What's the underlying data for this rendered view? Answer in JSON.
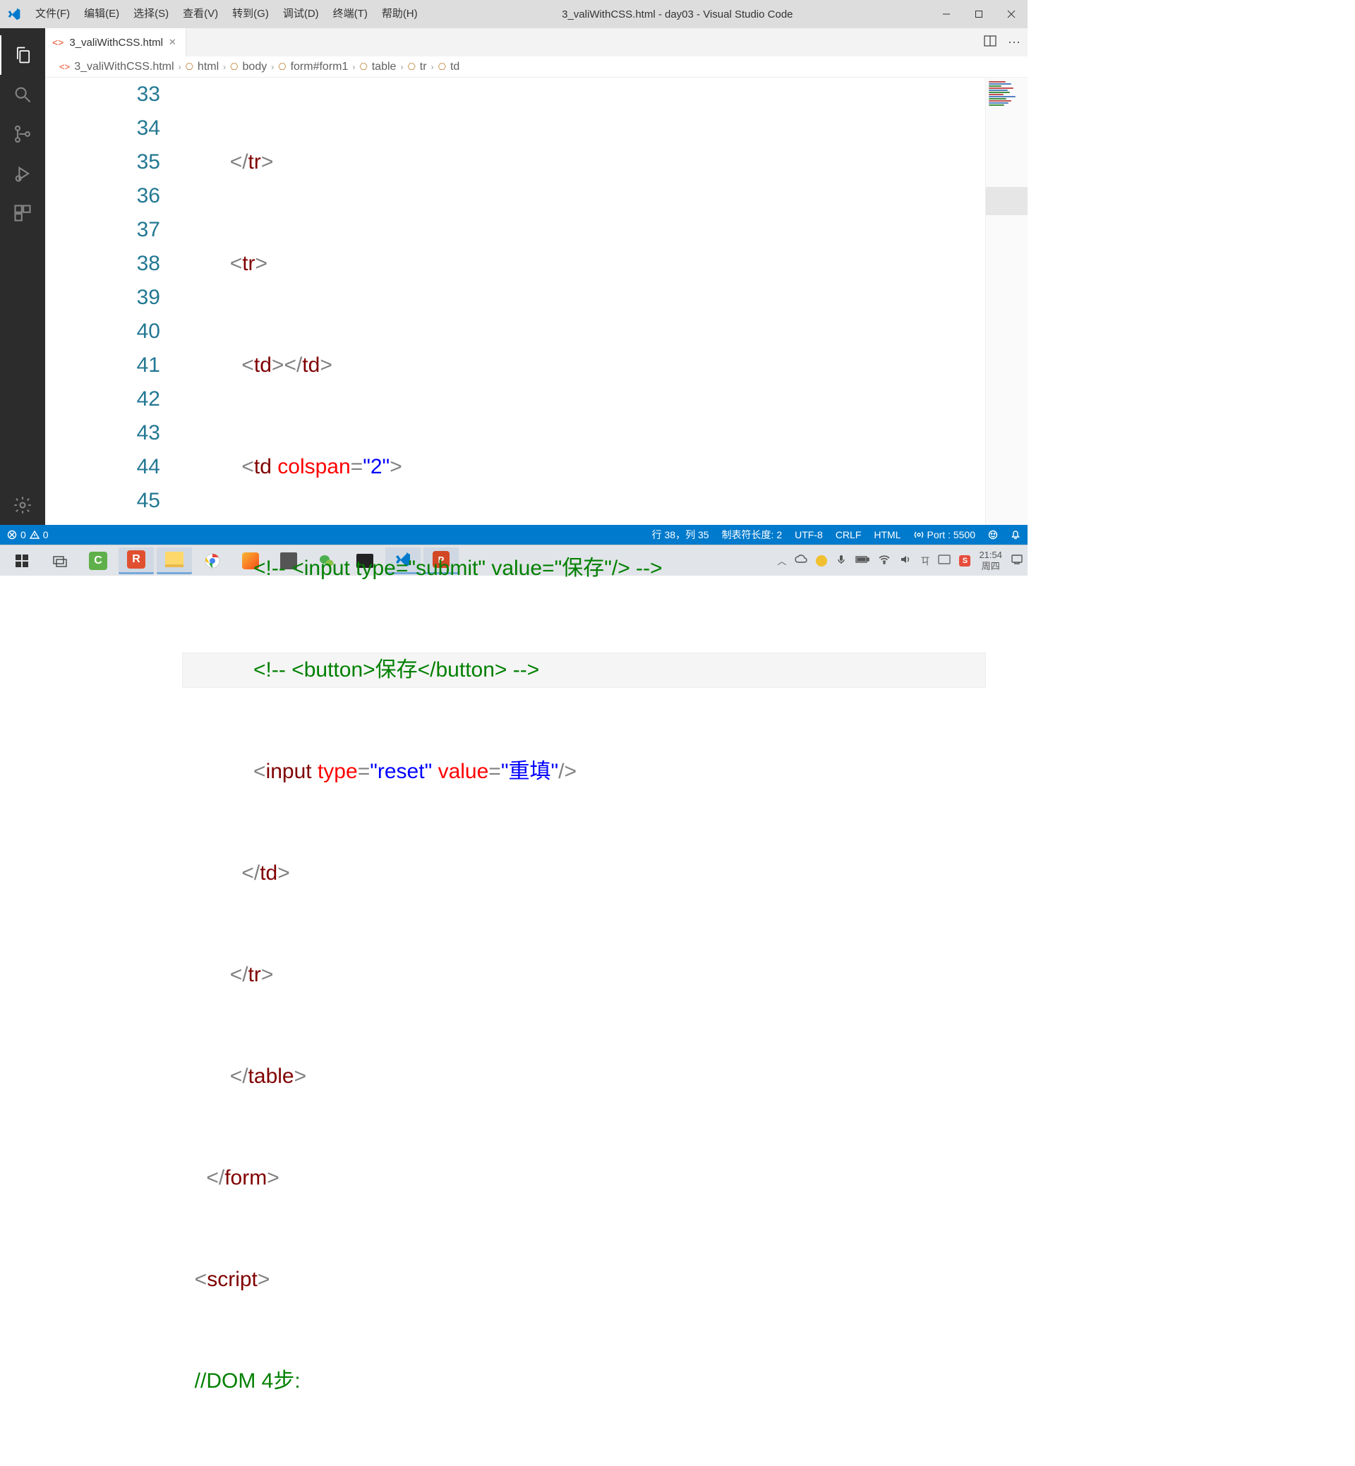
{
  "window": {
    "title": "3_valiWithCSS.html - day03 - Visual Studio Code"
  },
  "menu": {
    "file": "文件(F)",
    "edit": "编辑(E)",
    "selection": "选择(S)",
    "view": "查看(V)",
    "go": "转到(G)",
    "debug": "调试(D)",
    "terminal": "终端(T)",
    "help": "帮助(H)"
  },
  "tab": {
    "filename": "3_valiWithCSS.html"
  },
  "breadcrumb": {
    "file": "3_valiWithCSS.html",
    "p1": "html",
    "p2": "body",
    "p3": "form#form1",
    "p4": "table",
    "p5": "tr",
    "p6": "td"
  },
  "lines": {
    "n33": "33",
    "n34": "34",
    "n35": "35",
    "n36": "36",
    "n37": "37",
    "n38": "38",
    "n39": "39",
    "n40": "40",
    "n41": "41",
    "n42": "42",
    "n43": "43",
    "n44": "44",
    "n45": "45"
  },
  "code": {
    "l33_close_tr": "tr",
    "l34_open_tr": "tr",
    "l35_td_open": "td",
    "l35_td_close": "td",
    "l36_td": "td",
    "l36_colspan_attr": "colspan",
    "l36_colspan_val": "\"2\"",
    "l37_comment": "<!-- <input type=\"submit\" value=\"保存\"/> -->",
    "l38_comment": "<!-- <button>保存</button> -->",
    "l39_input": "input",
    "l39_type_attr": "type",
    "l39_type_val": "\"reset\"",
    "l39_value_attr": "value",
    "l39_value_val": "\"重填\"",
    "l40_close_td": "td",
    "l41_close_tr": "tr",
    "l42_close_table": "table",
    "l43_close_form": "form",
    "l44_open_script": "script",
    "l45_comment": "//DOM 4步:"
  },
  "status": {
    "errors": "0",
    "warnings": "0",
    "cursor": "行 38，列 35",
    "tab_size": "制表符长度: 2",
    "encoding": "UTF-8",
    "eol": "CRLF",
    "lang": "HTML",
    "port": "Port : 5500"
  },
  "taskbar": {
    "time": "21:54",
    "date": "周四"
  }
}
